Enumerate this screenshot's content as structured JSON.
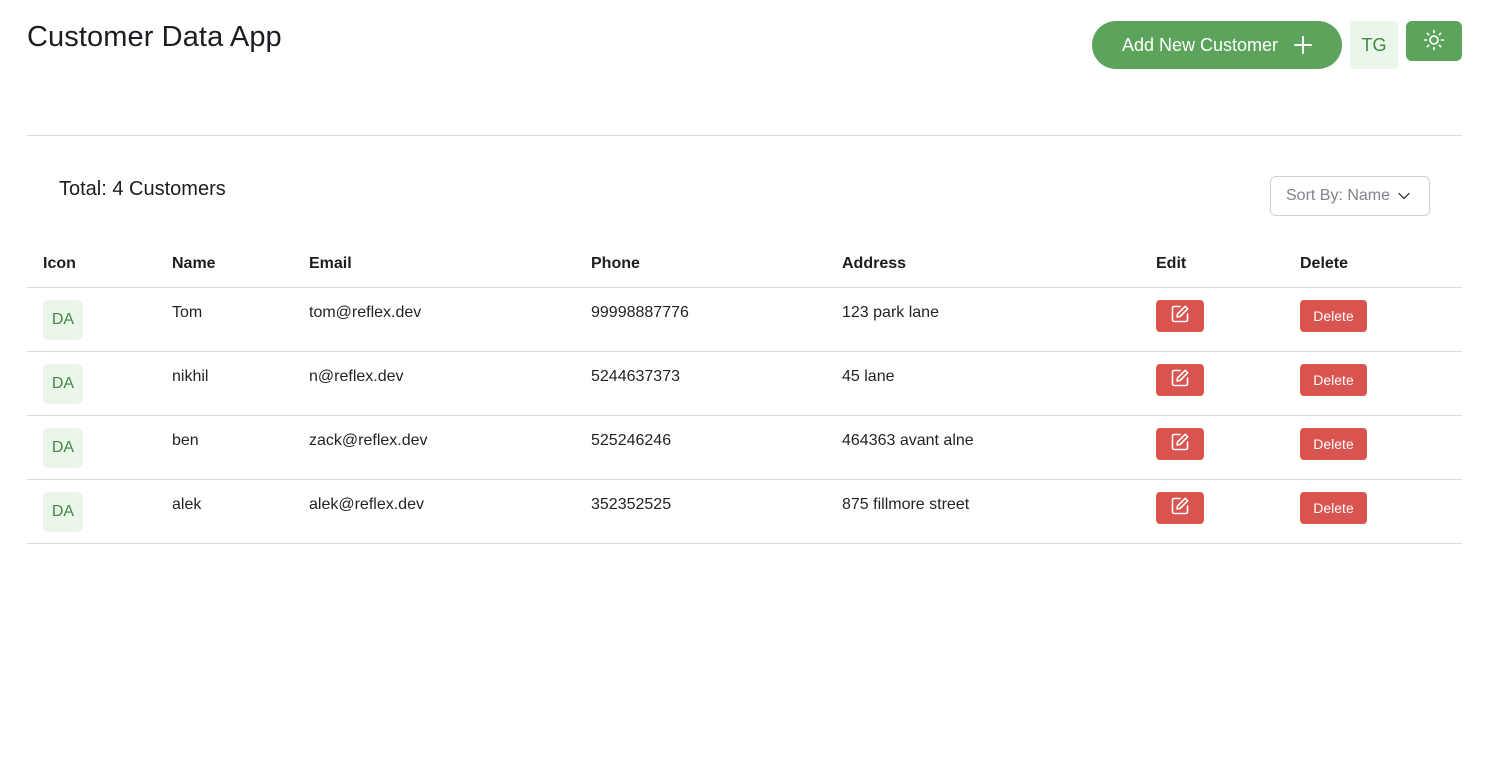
{
  "app": {
    "title": "Customer Data App"
  },
  "header": {
    "add_button_label": "Add New Customer",
    "user_avatar": "TG",
    "theme_toggle_icon": "sun-icon"
  },
  "summary": {
    "total_label": "Total: 4 Customers"
  },
  "sort": {
    "selected": "Sort By: Name"
  },
  "table": {
    "headers": {
      "icon": "Icon",
      "name": "Name",
      "email": "Email",
      "phone": "Phone",
      "address": "Address",
      "edit": "Edit",
      "delete": "Delete"
    },
    "rows": [
      {
        "avatar": "DA",
        "name": "Tom",
        "email": "tom@reflex.dev",
        "phone": "99998887776",
        "address": "123 park lane",
        "delete_label": "Delete"
      },
      {
        "avatar": "DA",
        "name": "nikhil",
        "email": "n@reflex.dev",
        "phone": "5244637373",
        "address": "45 lane",
        "delete_label": "Delete"
      },
      {
        "avatar": "DA",
        "name": "ben",
        "email": "zack@reflex.dev",
        "phone": "525246246",
        "address": "464363 avant alne",
        "delete_label": "Delete"
      },
      {
        "avatar": "DA",
        "name": "alek",
        "email": "alek@reflex.dev",
        "phone": "352352525",
        "address": "875 fillmore street",
        "delete_label": "Delete"
      }
    ]
  },
  "colors": {
    "accent_green": "#5ca35c",
    "avatar_bg": "#e9f6e9",
    "avatar_text": "#3d8a45",
    "danger_red": "#d9534f"
  }
}
